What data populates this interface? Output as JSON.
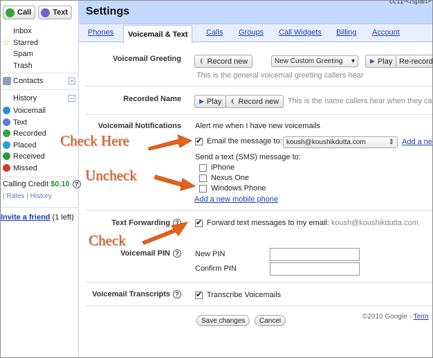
{
  "rail": {
    "call": "Call",
    "text": "Text",
    "inbox": "Inbox",
    "starred": "Starred",
    "spam": "Spam",
    "trash": "Trash",
    "contacts": "Contacts",
    "history": "History",
    "history_items": [
      "Voicemail",
      "Text",
      "Recorded",
      "Placed",
      "Received",
      "Missed"
    ],
    "history_colors": [
      "#2a8fd8",
      "#5c7bd6",
      "#3aa43a",
      "#2b9be0",
      "#2e9a3c",
      "#d43a2a"
    ],
    "credit_label": "Calling Credit",
    "credit_value": "$0.10",
    "rates": "Rates",
    "history_link": "History",
    "invite": "Invite a friend",
    "invite_count": "(1 left)"
  },
  "header": {
    "title": "Settings"
  },
  "tabs": [
    "Phones",
    "Voicemail & Text",
    "Calls",
    "Groups",
    "Call Widgets",
    "Billing",
    "Account"
  ],
  "active_tab": "Voicemail & Text",
  "greeting": {
    "label": "Voicemail Greeting",
    "record": "Record new",
    "select": "New Custom Greeting",
    "play": "Play",
    "rerecord": "Re-record",
    "hint": "This is the general voicemail greeting callers hear"
  },
  "recorded_name": {
    "label": "Recorded Name",
    "play": "Play",
    "record": "Record new",
    "hint": "This is the name callers hear when they ca"
  },
  "notifications": {
    "label": "Voicemail Notifications",
    "alert": "Alert me when I have new voicemails",
    "email_label": "Email the message to:",
    "email_value": "koush@koushikdutta.com",
    "add_email": "Add a ne",
    "sms_label": "Send a text (SMS) message to:",
    "phones": [
      "iPhone",
      "Nexus One",
      "Windows Phone"
    ],
    "add_phone": "Add a new mobile phone"
  },
  "forwarding": {
    "label": "Text Forwarding",
    "text": "Forward text messages to my email:",
    "email": "koush@koushikdutta.com"
  },
  "pin": {
    "label": "Voicemail PIN",
    "new_pin": "New PIN",
    "confirm_pin": "Confirm PIN"
  },
  "transcripts": {
    "label": "Voicemail Transcripts",
    "text": "Transcribe Voicemails"
  },
  "footer": {
    "save": "Save changes",
    "cancel": "Cancel",
    "copyright": "©2010 Google -",
    "terms": "Term"
  },
  "annotations": {
    "check_here": "Check Here",
    "uncheck": "Uncheck",
    "check": "Check",
    "accent": "#e85d10"
  },
  "top_fragment": "cc11-</span>"
}
